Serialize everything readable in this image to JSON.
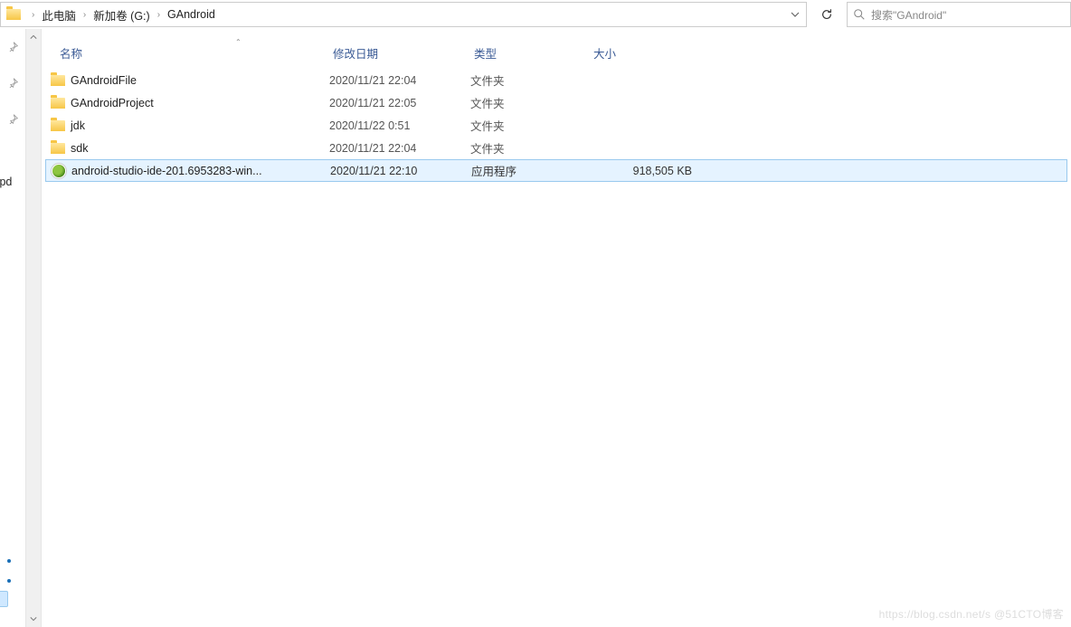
{
  "breadcrumb": {
    "parts": [
      "此电脑",
      "新加卷 (G:)",
      "GAndroid"
    ]
  },
  "search": {
    "placeholder": "搜索\"GAndroid\""
  },
  "columns": {
    "name": "名称",
    "date": "修改日期",
    "type": "类型",
    "size": "大小"
  },
  "left": {
    "upd_label": "e Upd"
  },
  "files": [
    {
      "icon": "folder",
      "name": "GAndroidFile",
      "date": "2020/11/21 22:04",
      "type": "文件夹",
      "size": "",
      "selected": false
    },
    {
      "icon": "folder",
      "name": "GAndroidProject",
      "date": "2020/11/21 22:05",
      "type": "文件夹",
      "size": "",
      "selected": false
    },
    {
      "icon": "folder",
      "name": "jdk",
      "date": "2020/11/22 0:51",
      "type": "文件夹",
      "size": "",
      "selected": false
    },
    {
      "icon": "folder",
      "name": "sdk",
      "date": "2020/11/21 22:04",
      "type": "文件夹",
      "size": "",
      "selected": false
    },
    {
      "icon": "app",
      "name": "android-studio-ide-201.6953283-win...",
      "date": "2020/11/21 22:10",
      "type": "应用程序",
      "size": "918,505 KB",
      "selected": true
    }
  ],
  "watermark": "https://blog.csdn.net/s @51CTO博客"
}
